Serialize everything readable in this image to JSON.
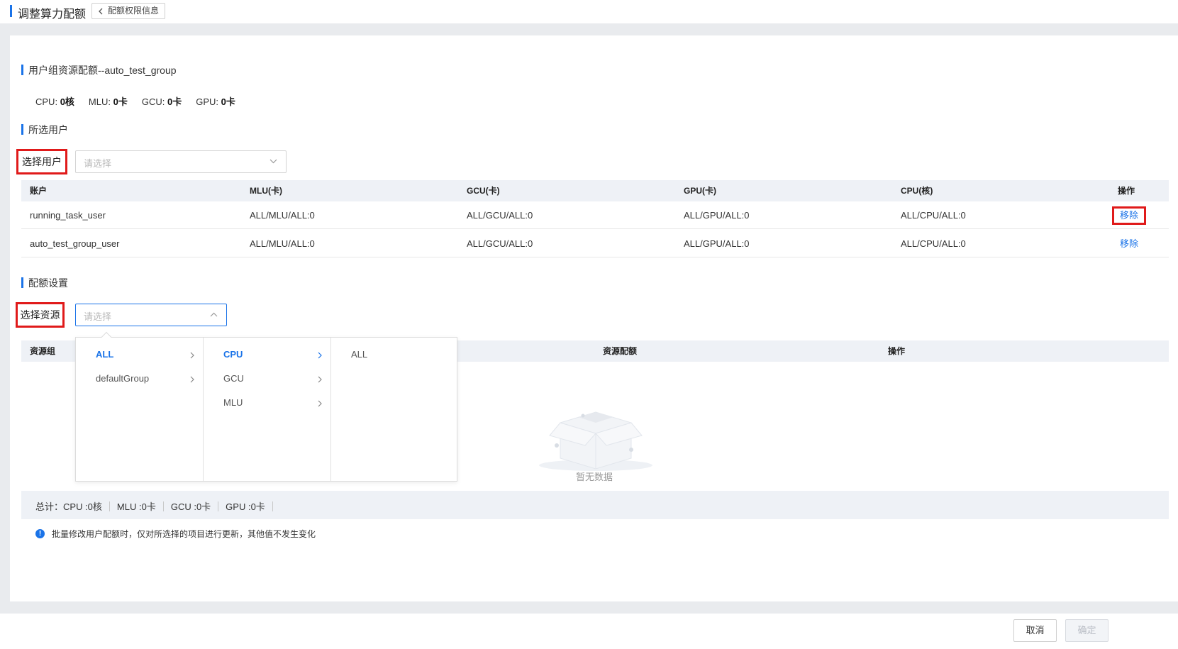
{
  "header": {
    "title": "调整算力配额",
    "back_label": "配额权限信息"
  },
  "group_section": {
    "title": "用户组资源配额--auto_test_group",
    "quotas": [
      {
        "label": "CPU:",
        "value": "0核"
      },
      {
        "label": "MLU:",
        "value": "0卡"
      },
      {
        "label": "GCU:",
        "value": "0卡"
      },
      {
        "label": "GPU:",
        "value": "0卡"
      }
    ]
  },
  "users_section": {
    "title": "所选用户",
    "select_label": "选择用户",
    "select_placeholder": "请选择",
    "columns": [
      "账户",
      "MLU(卡)",
      "GCU(卡)",
      "GPU(卡)",
      "CPU(核)",
      "操作"
    ],
    "rows": [
      {
        "account": "running_task_user",
        "mlu": "ALL/MLU/ALL:0",
        "gcu": "ALL/GCU/ALL:0",
        "gpu": "ALL/GPU/ALL:0",
        "cpu": "ALL/CPU/ALL:0",
        "action": "移除"
      },
      {
        "account": "auto_test_group_user",
        "mlu": "ALL/MLU/ALL:0",
        "gcu": "ALL/GCU/ALL:0",
        "gpu": "ALL/GPU/ALL:0",
        "cpu": "ALL/CPU/ALL:0",
        "action": "移除"
      }
    ]
  },
  "quota_section": {
    "title": "配额设置",
    "select_label": "选择资源",
    "select_placeholder": "请选择",
    "columns": [
      "资源组",
      "资源配额",
      "操作"
    ],
    "cascader": {
      "col1": [
        {
          "label": "ALL",
          "active": true
        },
        {
          "label": "defaultGroup",
          "active": false
        }
      ],
      "col2": [
        {
          "label": "CPU",
          "active": true
        },
        {
          "label": "GCU",
          "active": false
        },
        {
          "label": "MLU",
          "active": false
        }
      ],
      "col3": [
        {
          "label": "ALL",
          "active": false
        }
      ]
    },
    "empty_text": "暂无数据",
    "total": {
      "label": "总计：",
      "items": [
        "CPU :0核",
        "MLU :0卡",
        "GCU :0卡",
        "GPU :0卡"
      ]
    },
    "hint": "批量修改用户配额时，仅对所选择的项目进行更新，其他值不发生变化"
  },
  "footer": {
    "cancel_label": "取消",
    "confirm_label": "确定"
  },
  "colors": {
    "accent": "#1a73e8",
    "highlight_border": "#e01a1a"
  }
}
